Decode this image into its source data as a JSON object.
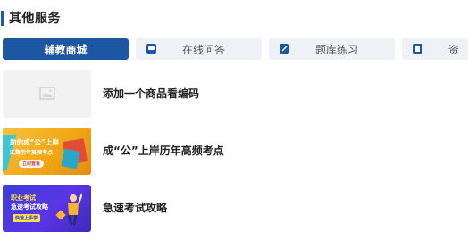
{
  "section": {
    "title": "其他服务"
  },
  "tabs": [
    {
      "label": "辅教商城",
      "icon": "none",
      "active": true
    },
    {
      "label": "在线问答",
      "icon": "chat-icon",
      "active": false
    },
    {
      "label": "题库练习",
      "icon": "edit-icon",
      "active": false
    },
    {
      "label": "资",
      "icon": "document-icon",
      "active": false
    }
  ],
  "items": [
    {
      "title": "添加一个商品看编码",
      "thumbnail": "image-placeholder-icon"
    },
    {
      "title": "成“公”上岸历年高频考点",
      "thumbnail_text": {
        "line1": "助你成“公”上岸",
        "line2": "汇集历年高频考点",
        "pill": "立即查看"
      }
    },
    {
      "title": "急速考试攻略",
      "thumbnail_text": {
        "line1": "职业考试",
        "line2": "急速考试攻略",
        "pill": "快速上手学"
      }
    }
  ],
  "colors": {
    "accent": "#1d56a3",
    "tab_bg": "#eef2f7",
    "thumb_yellow": "#f2a91f",
    "thumb_blue": "#4a3ae0"
  }
}
